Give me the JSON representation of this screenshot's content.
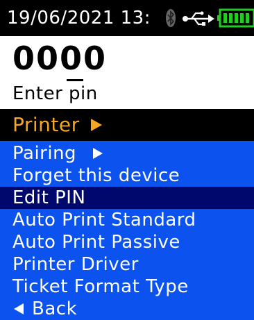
{
  "status_bar": {
    "datetime": "19/06/2021 13:",
    "icons": [
      "bluetooth-icon",
      "usb-icon",
      "battery-icon"
    ],
    "battery_color": "#22cc22"
  },
  "pin_entry": {
    "value": "0000",
    "prompt": "Enter pin"
  },
  "menu": {
    "title": "Printer",
    "title_color": "#f5a623",
    "items": [
      {
        "label": "Pairing",
        "has_submenu": true
      },
      {
        "label": "Forget this device"
      },
      {
        "label": "Edit PIN",
        "selected": true
      },
      {
        "label": "Auto Print Standard"
      },
      {
        "label": "Auto Print Passive"
      },
      {
        "label": "Printer Driver"
      },
      {
        "label": "Ticket Format Type"
      }
    ],
    "back_label": "Back",
    "background_color": "#0b52ef",
    "selected_color": "#00086e"
  }
}
